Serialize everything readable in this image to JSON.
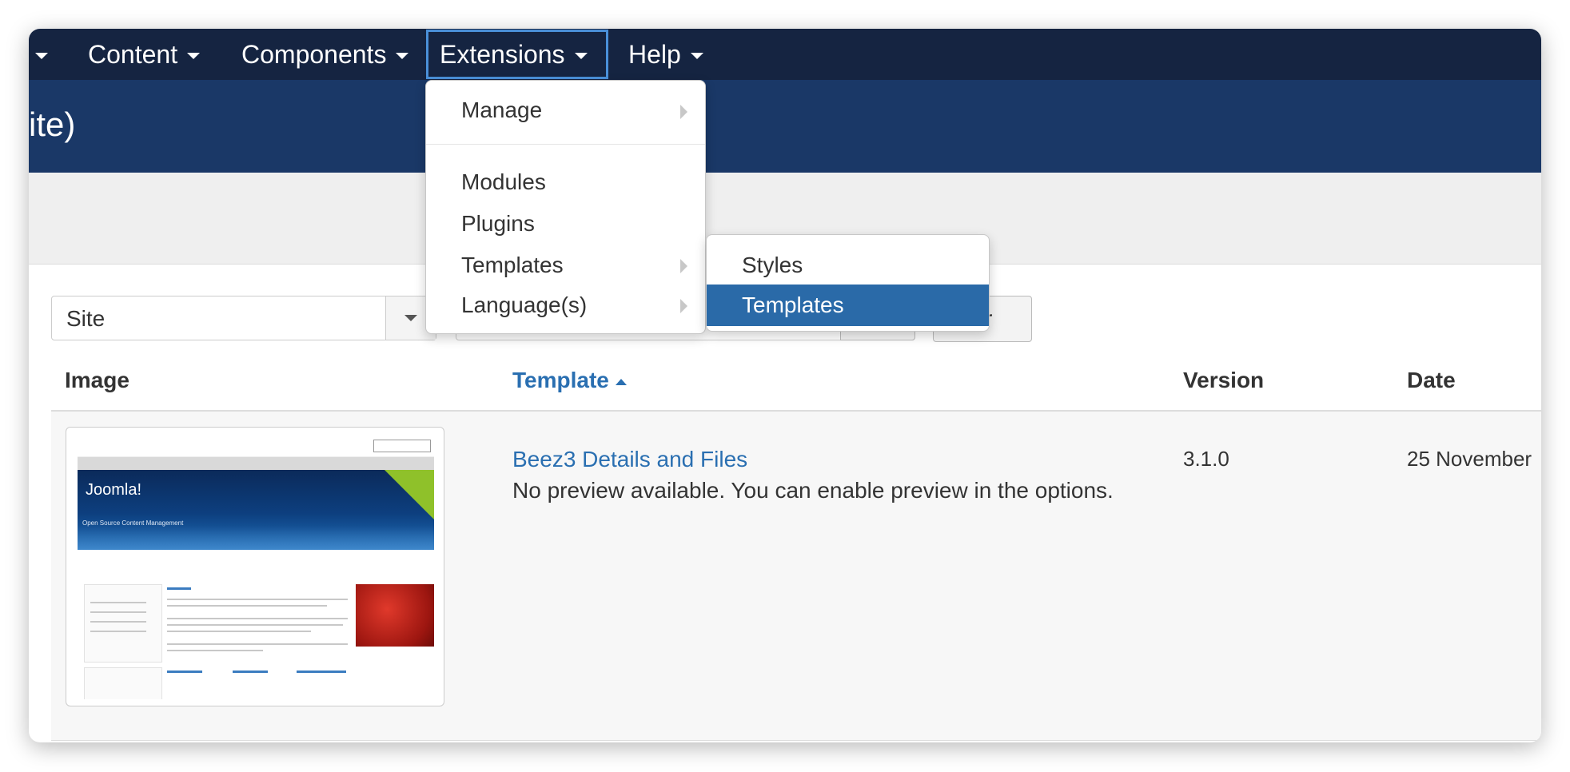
{
  "navbar": {
    "items": [
      {
        "label": "Content"
      },
      {
        "label": "Components"
      },
      {
        "label": "Extensions"
      },
      {
        "label": "Help"
      }
    ]
  },
  "header": {
    "title": "ite)"
  },
  "filters": {
    "client_select_value": "Site",
    "clear_button_visible_text": "ar"
  },
  "table": {
    "columns": {
      "image": "Image",
      "template": "Template",
      "version": "Version",
      "date": "Date"
    },
    "rows": [
      {
        "title": "Beez3 Details and Files",
        "description": "No preview available. You can enable preview in the options.",
        "version": "3.1.0",
        "date": "25 November"
      }
    ]
  },
  "thumbnail": {
    "logo": "Joomla!",
    "tagline": "Open Source Content Management"
  },
  "extensions_menu": {
    "items": [
      {
        "label": "Manage",
        "has_submenu": true
      },
      {
        "label": "Modules",
        "has_submenu": false
      },
      {
        "label": "Plugins",
        "has_submenu": false
      },
      {
        "label": "Templates",
        "has_submenu": true
      },
      {
        "label": "Language(s)",
        "has_submenu": true
      }
    ]
  },
  "templates_submenu": {
    "items": [
      {
        "label": "Styles"
      },
      {
        "label": "Templates",
        "highlighted": true
      }
    ]
  },
  "colors": {
    "navbar": "#152441",
    "header": "#1a3867",
    "link": "#2a6fb1",
    "highlight": "#2a6aa8"
  }
}
